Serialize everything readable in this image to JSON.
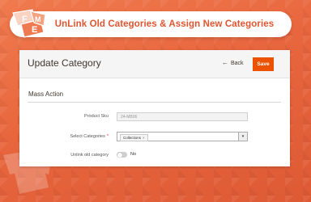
{
  "banner": {
    "title": "UnLink Old Categories & Assign New Categories",
    "logo_letters": "FME"
  },
  "page": {
    "title": "Update Category",
    "back_label": "Back",
    "save_label": "Save"
  },
  "section": {
    "title": "Mass Action"
  },
  "form": {
    "product_sku": {
      "label": "Product Sku",
      "value": "24-MB06"
    },
    "select_categories": {
      "label": "Select Categories",
      "required_mark": "*",
      "selected": [
        "Collections"
      ],
      "remove_mark": "×"
    },
    "unlink_old_category": {
      "label": "Unlink old category",
      "value": "No",
      "checked": false
    }
  },
  "colors": {
    "accent": "#eb5202",
    "banner_text": "#e0552f",
    "background": "#e8663e"
  },
  "icons": {
    "back": "arrow-left-icon",
    "dropdown": "caret-down-icon",
    "chip_remove": "close-icon"
  }
}
